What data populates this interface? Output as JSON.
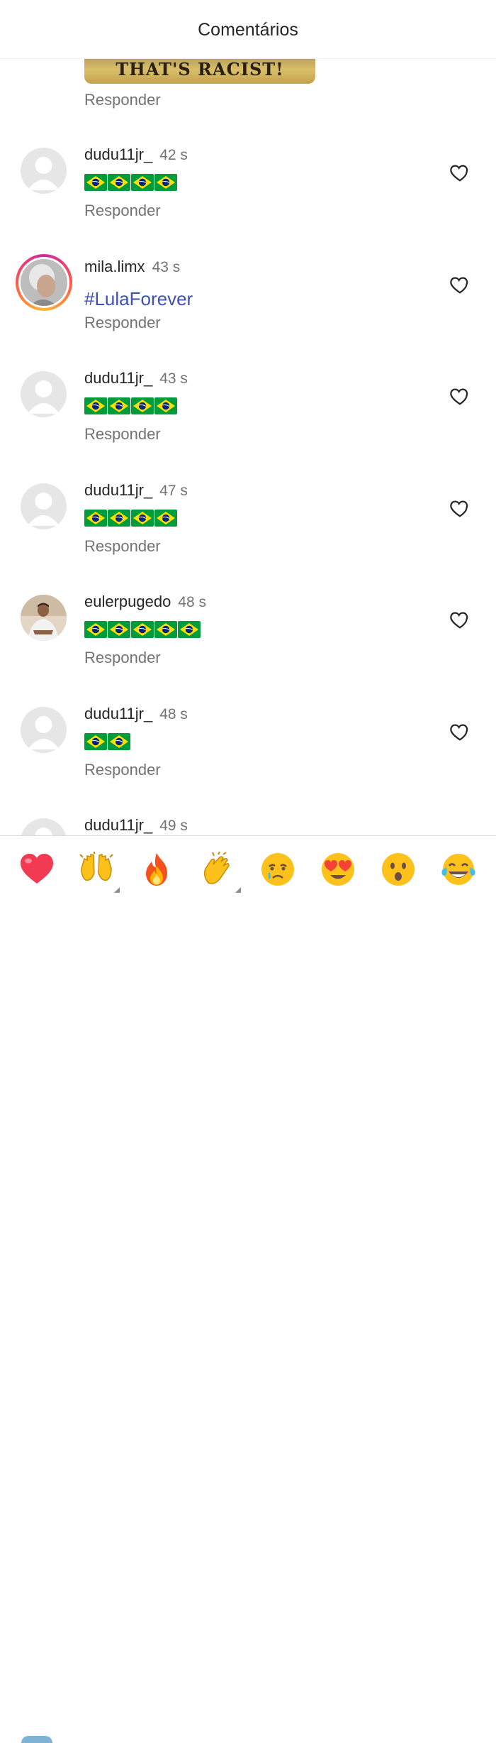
{
  "header": {
    "title": "Comentários"
  },
  "previous": {
    "gif_text": "THAT'S RACIST!",
    "reply_label": "Responder"
  },
  "comments": [
    {
      "username": "dudu11jr_",
      "time": "42 s",
      "flags": 4,
      "reply_label": "Responder",
      "avatar": "default"
    },
    {
      "username": "mila.limx",
      "time": "43 s",
      "text": "#LulaForever",
      "reply_label": "Responder",
      "avatar": "story"
    },
    {
      "username": "dudu11jr_",
      "time": "43 s",
      "flags": 4,
      "reply_label": "Responder",
      "avatar": "default"
    },
    {
      "username": "dudu11jr_",
      "time": "47 s",
      "flags": 4,
      "reply_label": "Responder",
      "avatar": "default"
    },
    {
      "username": "eulerpugedo",
      "time": "48 s",
      "flags": 5,
      "reply_label": "Responder",
      "avatar": "photo"
    },
    {
      "username": "dudu11jr_",
      "time": "48 s",
      "flags": 2,
      "reply_label": "Responder",
      "avatar": "default"
    },
    {
      "username": "dudu11jr_",
      "time": "49 s",
      "avatar": "default"
    }
  ],
  "reactions": [
    {
      "name": "heart",
      "icon": "heart-icon"
    },
    {
      "name": "raised-hands",
      "icon": "raised-hands-icon",
      "has_variants": true
    },
    {
      "name": "fire",
      "icon": "fire-icon"
    },
    {
      "name": "clapping-hands",
      "icon": "clapping-hands-icon",
      "has_variants": true
    },
    {
      "name": "crying-face",
      "icon": "crying-face-icon"
    },
    {
      "name": "heart-eyes",
      "icon": "heart-eyes-icon"
    },
    {
      "name": "surprised-face",
      "icon": "surprised-face-icon"
    },
    {
      "name": "tears-of-joy",
      "icon": "tears-of-joy-icon"
    }
  ],
  "colors": {
    "hashtag": "#3f51b5",
    "secondary_text": "#737373",
    "flag_green": "#009b3a",
    "flag_yellow": "#fedf00",
    "flag_blue": "#002776"
  }
}
